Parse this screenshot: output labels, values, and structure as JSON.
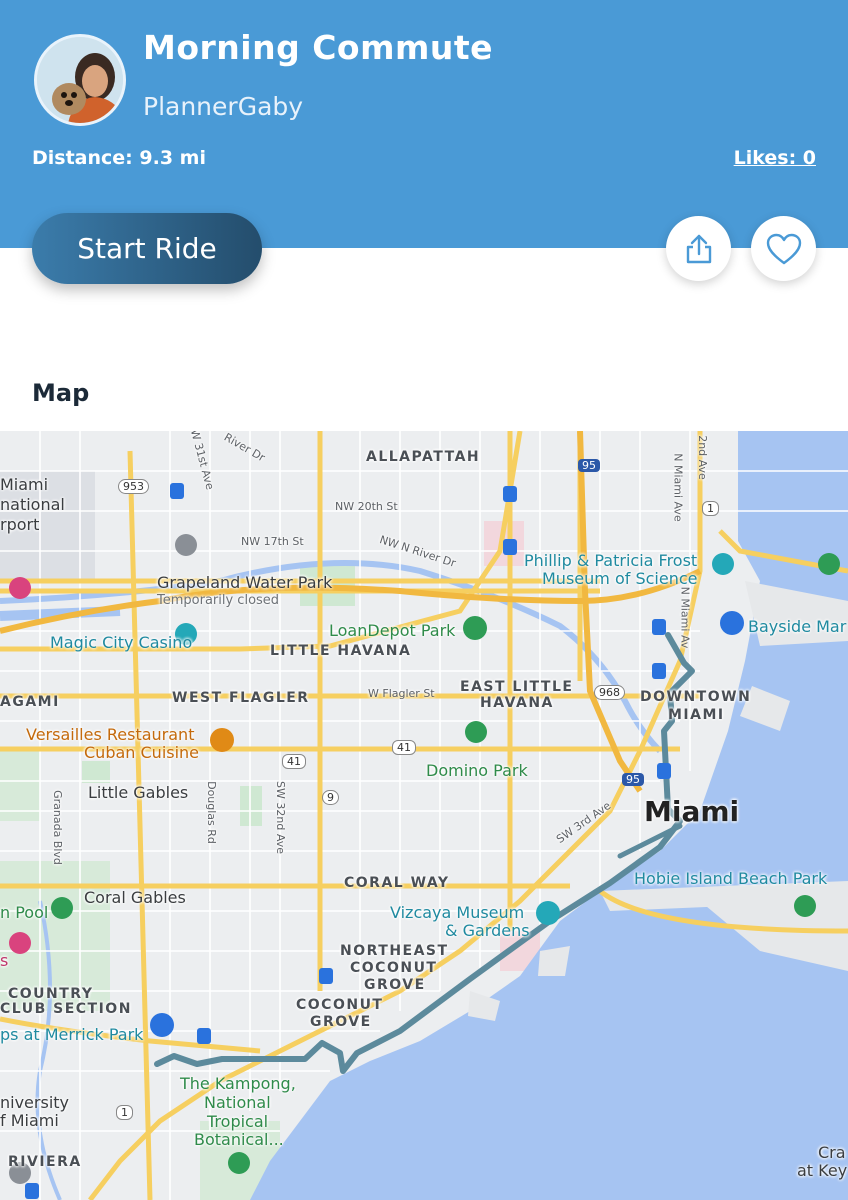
{
  "header": {
    "title": "Morning Commute",
    "username": "PlannerGaby",
    "distance": "Distance: 9.3 mi",
    "likes": "Likes: 0",
    "start_button": "Start Ride",
    "bg_color": "#4a9ad6"
  },
  "actions": {
    "share_icon": "share-icon",
    "like_icon": "heart-icon"
  },
  "map_section": {
    "title": "Map"
  },
  "map": {
    "neighborhoods": [
      "ALLAPATTAH",
      "LITTLE HAVANA",
      "EAST LITTLE",
      "HAVANA",
      "WEST FLAGLER",
      "AGAMI",
      "DOWNTOWN",
      "MIAMI",
      "CORAL WAY",
      "NORTHEAST",
      "COCONUT",
      "GROVE",
      "COCONUT",
      "GROVE",
      "COUNTRY",
      "CLUB SECTION",
      "RIVIERA"
    ],
    "streets": [
      "NW 31st Ave",
      "River Dr",
      "NW 20th St",
      "NW 17th St",
      "NW N River Dr",
      "W Flagler St",
      "Douglas Rd",
      "SW 32nd Ave",
      "Granada Blvd",
      "SW 3rd Ave",
      "N Miami Ave",
      "N Miami Av",
      "2nd Ave"
    ],
    "places": {
      "airport_1": "Miami",
      "airport_2": "national",
      "airport_3": "rport",
      "park_1": "Grapeland Water Park",
      "park_1_note": "Temporarily closed",
      "casino": "Magic City Casino",
      "stadium": "LoanDepot Park",
      "museum_1": "Phillip & Patricia Frost",
      "museum_2": "Museum of Science",
      "bayside": "Bayside Mar",
      "restaurant_1": "Versailles Restaurant",
      "restaurant_2": "Cuban Cuisine",
      "domino": "Domino Park",
      "little_gables": "Little Gables",
      "city": "Miami",
      "hobie": "Hobie Island Beach Park",
      "coral_gables": "Coral Gables",
      "pool": "n Pool",
      "hotel": "s",
      "vizcaya_1": "Vizcaya Museum",
      "vizcaya_2": "& Gardens",
      "merrick": "ps at Merrick Park",
      "kampong_1": "The Kampong,",
      "kampong_2": "National",
      "kampong_3": "Tropical",
      "kampong_4": "Botanical...",
      "univ_1": "niversity",
      "univ_2": "f Miami",
      "key_1": "Cra",
      "key_2": "at Key"
    },
    "shields": [
      "953",
      "95",
      "1",
      "968",
      "41",
      "41",
      "9",
      "95",
      "1"
    ],
    "route_color": "#5c8a9c",
    "water_color": "#a6c4f2"
  }
}
